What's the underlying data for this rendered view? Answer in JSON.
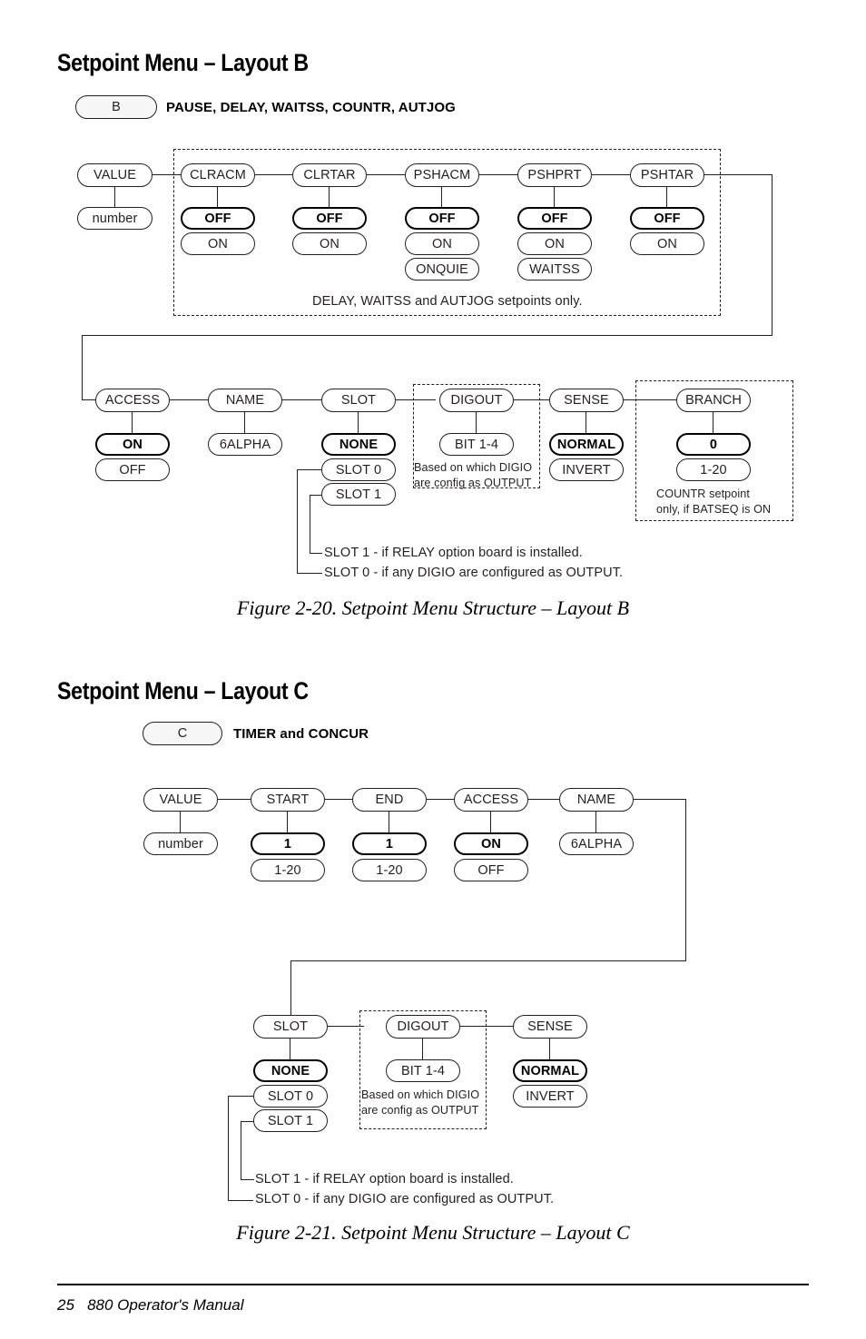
{
  "page": {
    "footer_page_number": "25",
    "footer_title": "880 Operator's  Manual"
  },
  "sections": [
    {
      "heading": "Setpoint Menu – Layout B",
      "tag": "B",
      "tag_description": "PAUSE, DELAY, WAITSS, COUNTR, AUTJOG",
      "caption": "Figure 2-20. Setpoint Menu Structure – Layout B",
      "group_note": "DELAY, WAITSS and AUTJOG setpoints only.",
      "row1": [
        {
          "label": "VALUE",
          "options": [
            {
              "text": "number",
              "bold": false
            }
          ]
        },
        {
          "label": "CLRACM",
          "options": [
            {
              "text": "OFF",
              "bold": true
            },
            {
              "text": "ON",
              "bold": false
            }
          ]
        },
        {
          "label": "CLRTAR",
          "options": [
            {
              "text": "OFF",
              "bold": true
            },
            {
              "text": "ON",
              "bold": false
            }
          ]
        },
        {
          "label": "PSHACM",
          "options": [
            {
              "text": "OFF",
              "bold": true
            },
            {
              "text": "ON",
              "bold": false
            },
            {
              "text": "ONQUIE",
              "bold": false
            }
          ]
        },
        {
          "label": "PSHPRT",
          "options": [
            {
              "text": "OFF",
              "bold": true
            },
            {
              "text": "ON",
              "bold": false
            },
            {
              "text": "WAITSS",
              "bold": false
            }
          ]
        },
        {
          "label": "PSHTAR",
          "options": [
            {
              "text": "OFF",
              "bold": true
            },
            {
              "text": "ON",
              "bold": false
            }
          ]
        }
      ],
      "row2": [
        {
          "label": "ACCESS",
          "options": [
            {
              "text": "ON",
              "bold": true
            },
            {
              "text": "OFF",
              "bold": false
            }
          ]
        },
        {
          "label": "NAME",
          "options": [
            {
              "text": "6ALPHA",
              "bold": false
            }
          ]
        },
        {
          "label": "SLOT",
          "options": [
            {
              "text": "NONE",
              "bold": true
            },
            {
              "text": "SLOT 0",
              "bold": false
            },
            {
              "text": "SLOT 1",
              "bold": false
            }
          ]
        },
        {
          "label": "DIGOUT",
          "options": [
            {
              "text": "BIT 1-4",
              "bold": false
            }
          ]
        },
        {
          "label": "SENSE",
          "options": [
            {
              "text": "NORMAL",
              "bold": true
            },
            {
              "text": "INVERT",
              "bold": false
            }
          ]
        },
        {
          "label": "BRANCH",
          "options": [
            {
              "text": "0",
              "bold": true
            },
            {
              "text": "1-20",
              "bold": false
            }
          ]
        }
      ],
      "digout_note_line1": "Based on which DIGIO",
      "digout_note_line2": "are config as OUTPUT",
      "branch_note_line1": "COUNTR setpoint",
      "branch_note_line2": "only, if BATSEQ is ON",
      "slot_note_1": "SLOT 1 - if RELAY option board is installed.",
      "slot_note_0": "SLOT 0 - if any DIGIO are configured as OUTPUT."
    },
    {
      "heading": "Setpoint Menu – Layout C",
      "tag": "C",
      "tag_description": "TIMER and CONCUR",
      "caption": "Figure 2-21. Setpoint Menu Structure – Layout C",
      "row1": [
        {
          "label": "VALUE",
          "options": [
            {
              "text": "number",
              "bold": false
            }
          ]
        },
        {
          "label": "START",
          "options": [
            {
              "text": "1",
              "bold": true
            },
            {
              "text": "1-20",
              "bold": false
            }
          ]
        },
        {
          "label": "END",
          "options": [
            {
              "text": "1",
              "bold": true
            },
            {
              "text": "1-20",
              "bold": false
            }
          ]
        },
        {
          "label": "ACCESS",
          "options": [
            {
              "text": "ON",
              "bold": true
            },
            {
              "text": "OFF",
              "bold": false
            }
          ]
        },
        {
          "label": "NAME",
          "options": [
            {
              "text": "6ALPHA",
              "bold": false
            }
          ]
        }
      ],
      "row2": [
        {
          "label": "SLOT",
          "options": [
            {
              "text": "NONE",
              "bold": true
            },
            {
              "text": "SLOT 0",
              "bold": false
            },
            {
              "text": "SLOT 1",
              "bold": false
            }
          ]
        },
        {
          "label": "DIGOUT",
          "options": [
            {
              "text": "BIT 1-4",
              "bold": false
            }
          ]
        },
        {
          "label": "SENSE",
          "options": [
            {
              "text": "NORMAL",
              "bold": true
            },
            {
              "text": "INVERT",
              "bold": false
            }
          ]
        }
      ],
      "digout_note_line1": "Based on which DIGIO",
      "digout_note_line2": "are config as OUTPUT",
      "slot_note_1": "SLOT 1 - if RELAY option board is installed.",
      "slot_note_0": "SLOT 0 - if any DIGIO are configured as OUTPUT."
    }
  ]
}
